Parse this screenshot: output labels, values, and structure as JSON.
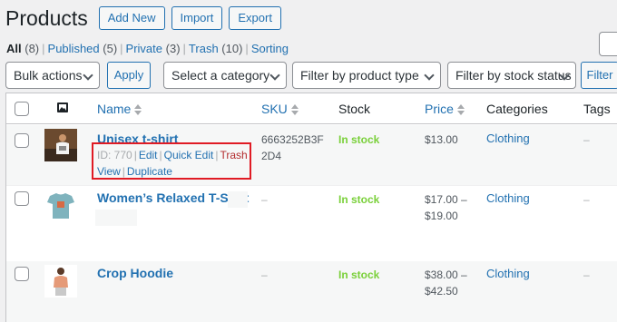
{
  "page": {
    "title": "Products",
    "buttons": [
      "Add New",
      "Import",
      "Export"
    ]
  },
  "filters": {
    "views": [
      {
        "label": "All",
        "count": "(8)"
      },
      {
        "label": "Published",
        "count": "(5)"
      },
      {
        "label": "Private",
        "count": "(3)"
      },
      {
        "label": "Trash",
        "count": "(10)"
      },
      {
        "label": "Sorting",
        "count": ""
      }
    ],
    "bulk_actions": "Bulk actions",
    "apply": "Apply",
    "category": "Select a category",
    "product_type": "Filter by product type",
    "stock_status": "Filter by stock status",
    "filter": "Filter"
  },
  "columns": {
    "name": "Name",
    "sku": "SKU",
    "stock": "Stock",
    "price": "Price",
    "categories": "Categories",
    "tags": "Tags"
  },
  "products": [
    {
      "name": "Unisex t-shirt",
      "sku_line1": "6663252B3F",
      "sku_line2": "2D4",
      "stock": "In stock",
      "price_line1": "$13.00",
      "price_line2": "",
      "category": "Clothing",
      "tags": "–",
      "row_actions": {
        "id": "ID: 770",
        "edit": "Edit",
        "quick_edit": "Quick Edit",
        "trash": "Trash",
        "view": "View",
        "duplicate": "Duplicate"
      }
    },
    {
      "name": "Women’s Relaxed T-Shirt",
      "sku_line1": "–",
      "sku_line2": "",
      "stock": "In stock",
      "price_line1": "$17.00 –",
      "price_line2": "$19.00",
      "category": "Clothing",
      "tags": "–"
    },
    {
      "name": "Crop Hoodie",
      "sku_line1": "–",
      "sku_line2": "",
      "stock": "In stock",
      "price_line1": "$38.00 –",
      "price_line2": "$42.50",
      "category": "Clothing",
      "tags": "–"
    }
  ],
  "colors": {
    "link": "#2271b1",
    "in_stock": "#7ad03a",
    "trash": "#b32d2e",
    "highlight_box": "#e01b24"
  }
}
